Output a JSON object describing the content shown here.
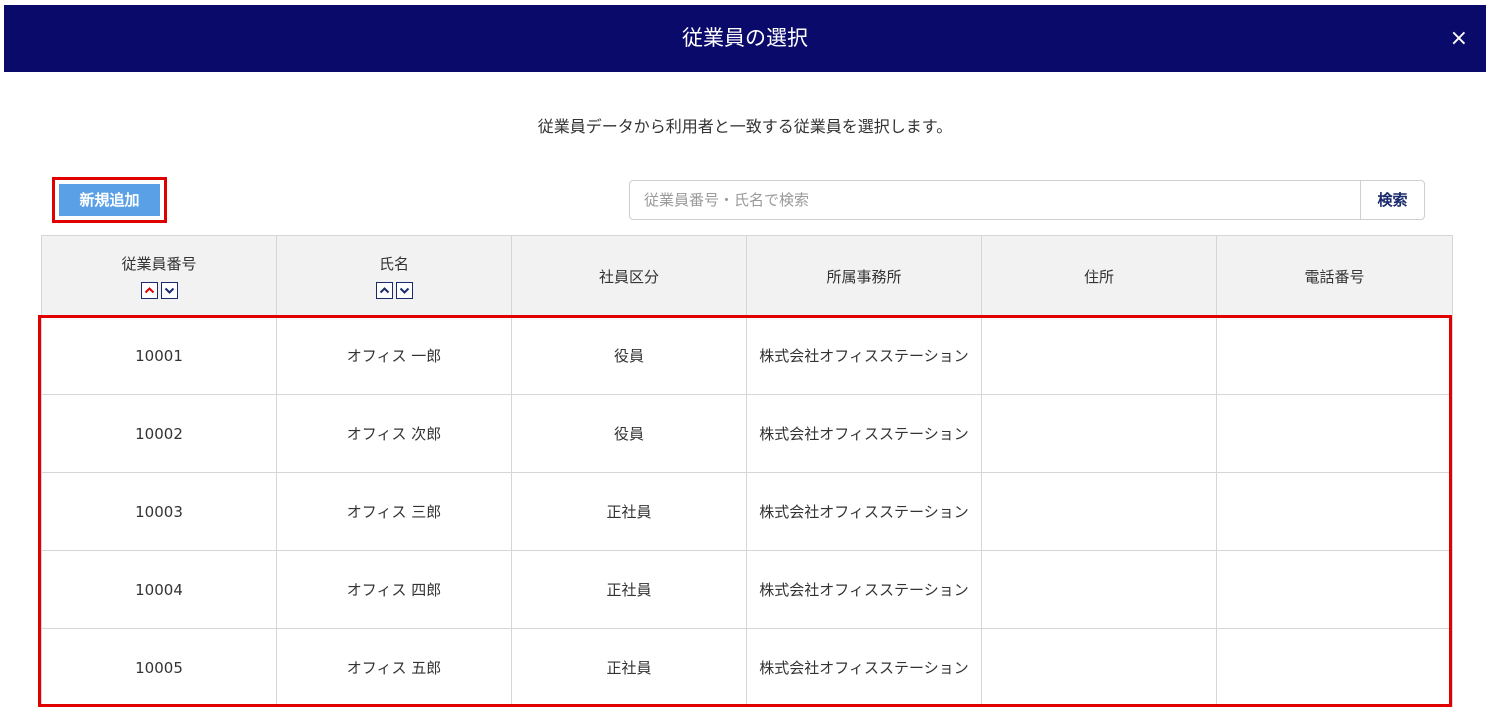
{
  "dialog": {
    "title": "従業員の選択",
    "close_label": "×",
    "description": "従業員データから利用者と一致する従業員を選択します。"
  },
  "toolbar": {
    "add_label": "新規追加",
    "search_placeholder": "従業員番号・氏名で検索",
    "search_label": "検索"
  },
  "table": {
    "headers": {
      "employee_number": "従業員番号",
      "name": "氏名",
      "employee_type": "社員区分",
      "office": "所属事務所",
      "address": "住所",
      "phone": "電話番号"
    },
    "rows": [
      {
        "employee_number": "10001",
        "name": "オフィス 一郎",
        "employee_type": "役員",
        "office": "株式会社オフィスステーション",
        "address": "",
        "phone": ""
      },
      {
        "employee_number": "10002",
        "name": "オフィス 次郎",
        "employee_type": "役員",
        "office": "株式会社オフィスステーション",
        "address": "",
        "phone": ""
      },
      {
        "employee_number": "10003",
        "name": "オフィス 三郎",
        "employee_type": "正社員",
        "office": "株式会社オフィスステーション",
        "address": "",
        "phone": ""
      },
      {
        "employee_number": "10004",
        "name": "オフィス 四郎",
        "employee_type": "正社員",
        "office": "株式会社オフィスステーション",
        "address": "",
        "phone": ""
      },
      {
        "employee_number": "10005",
        "name": "オフィス 五郎",
        "employee_type": "正社員",
        "office": "株式会社オフィスステーション",
        "address": "",
        "phone": ""
      }
    ]
  },
  "icons": {
    "sort_asc": "chevron-up-icon",
    "sort_desc": "chevron-down-icon",
    "close": "close-icon"
  },
  "colors": {
    "header_bg": "#0a0a6b",
    "add_button_bg": "#5aa0e6",
    "highlight": "#e00000",
    "sort_asc_arrow": "#e00000",
    "sort_desc_arrow": "#1a2a6c"
  }
}
